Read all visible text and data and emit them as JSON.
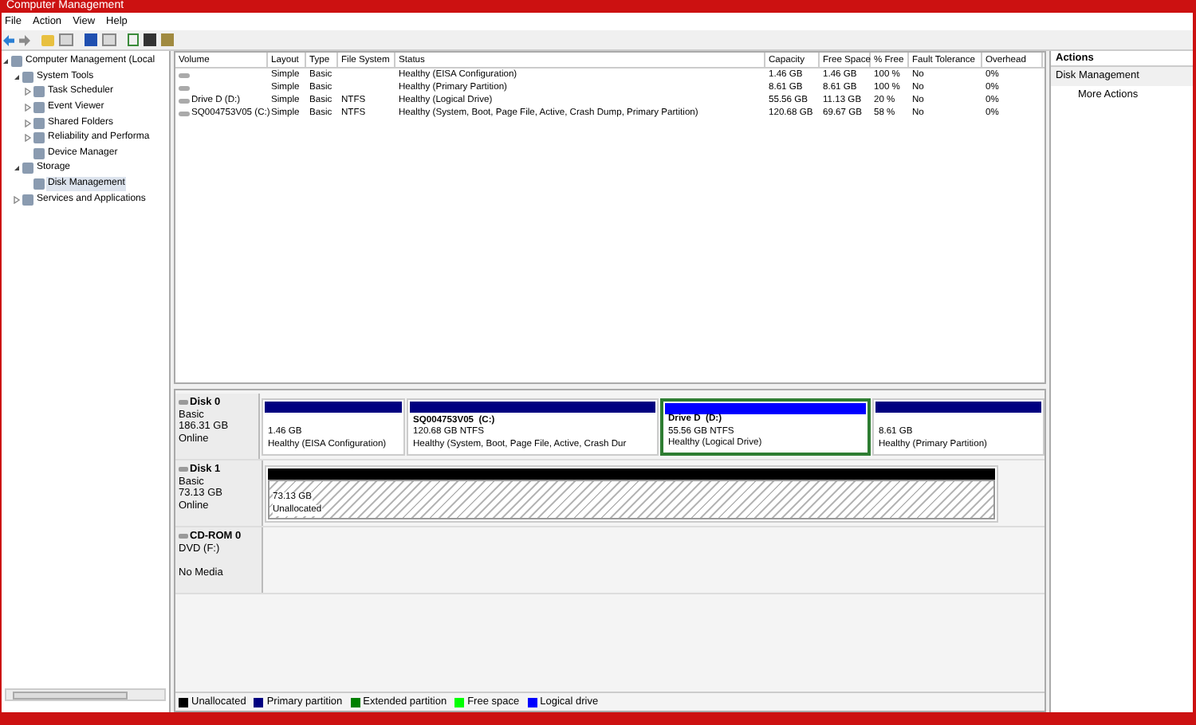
{
  "window": {
    "title": "Computer Management"
  },
  "menu": [
    "File",
    "Action",
    "View",
    "Help"
  ],
  "tree": [
    {
      "label": "Computer Management (Local",
      "expanded": true,
      "selected": false,
      "children": [
        {
          "label": "System Tools",
          "expanded": true,
          "selected": false,
          "children": [
            {
              "label": "Task Scheduler",
              "expanded": false,
              "selected": false
            },
            {
              "label": "Event Viewer",
              "expanded": false,
              "selected": false
            },
            {
              "label": "Shared Folders",
              "expanded": false,
              "selected": false
            },
            {
              "label": "Reliability and Performa",
              "expanded": false,
              "selected": false
            },
            {
              "label": "Device Manager",
              "selected": false
            }
          ]
        },
        {
          "label": "Storage",
          "expanded": true,
          "selected": false,
          "children": [
            {
              "label": "Disk Management",
              "selected": true
            }
          ]
        },
        {
          "label": "Services and Applications",
          "expanded": false,
          "selected": false
        }
      ]
    }
  ],
  "table": {
    "columns": [
      "Volume",
      "Layout",
      "Type",
      "File System",
      "Status",
      "Capacity",
      "Free Space",
      "% Free",
      "Fault Tolerance",
      "Overhead"
    ],
    "rows": [
      [
        "",
        "Simple",
        "Basic",
        "",
        "Healthy (EISA Configuration)",
        "1.46 GB",
        "1.46 GB",
        "100 %",
        "No",
        "0%"
      ],
      [
        "",
        "Simple",
        "Basic",
        "",
        "Healthy (Primary Partition)",
        "8.61 GB",
        "8.61 GB",
        "100 %",
        "No",
        "0%"
      ],
      [
        "Drive D (D:)",
        "Simple",
        "Basic",
        "NTFS",
        "Healthy (Logical Drive)",
        "55.56 GB",
        "11.13 GB",
        "20 %",
        "No",
        "0%"
      ],
      [
        "SQ004753V05 (C:)",
        "Simple",
        "Basic",
        "NTFS",
        "Healthy (System, Boot, Page File, Active, Crash Dump, Primary Partition)",
        "120.68 GB",
        "69.67 GB",
        "58 %",
        "No",
        "0%"
      ]
    ]
  },
  "disks": [
    {
      "name": "Disk 0",
      "lines": [
        "Basic",
        "186.31 GB",
        "Online"
      ],
      "partitions": [
        {
          "kind": "primary",
          "color": "#000080",
          "selected": false,
          "lines": [
            "1.46 GB",
            "Healthy (EISA Configuration)"
          ]
        },
        {
          "kind": "primary",
          "color": "#000080",
          "selected": false,
          "name": "SQ004753V05  (C:)",
          "lines": [
            "120.68 GB NTFS",
            "Healthy (System, Boot, Page File, Active, Crash Dur"
          ]
        },
        {
          "kind": "logical",
          "color": "#0000ff",
          "selected": true,
          "name": "Drive D  (D:)",
          "lines": [
            "55.56 GB NTFS",
            "Healthy (Logical Drive)"
          ]
        },
        {
          "kind": "primary",
          "color": "#000080",
          "selected": false,
          "lines": [
            "8.61 GB",
            "Healthy (Primary Partition)"
          ]
        }
      ]
    },
    {
      "name": "Disk 1",
      "lines": [
        "Basic",
        "73.13 GB",
        "Online"
      ],
      "partitions": [
        {
          "kind": "unallocated",
          "color": "#000000",
          "selected": false,
          "lines": [
            "73.13 GB",
            "Unallocated"
          ]
        }
      ]
    },
    {
      "name": "CD-ROM 0",
      "lines": [
        "DVD (F:)",
        "No Media"
      ]
    }
  ],
  "legend": [
    {
      "label": "Unallocated",
      "color": "#000000"
    },
    {
      "label": "Primary partition",
      "color": "#000080"
    },
    {
      "label": "Extended partition",
      "color": "#008000"
    },
    {
      "label": "Free space",
      "color": "#00ff00"
    },
    {
      "label": "Logical drive",
      "color": "#0000ff"
    }
  ],
  "actions": {
    "title": "Actions",
    "section": "Disk Management",
    "items": [
      "More Actions"
    ]
  }
}
